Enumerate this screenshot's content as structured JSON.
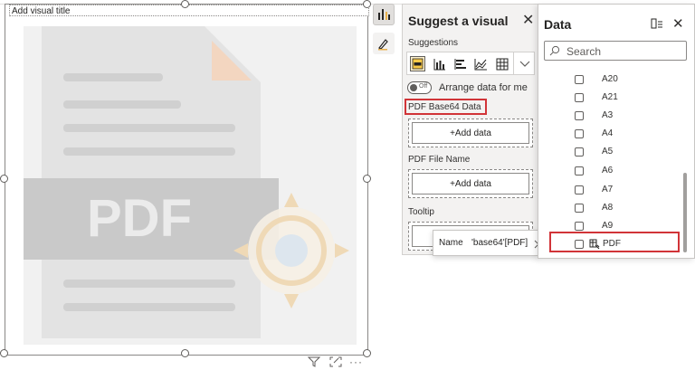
{
  "visual": {
    "title": "Add visual title",
    "placeholder_text": "PDF"
  },
  "suggest_pane": {
    "title": "Suggest a visual",
    "suggestions_label": "Suggestions",
    "toggle_state": "Off",
    "arrange_label": "Arrange data for me",
    "wells": [
      {
        "label": "PDF Base64 Data",
        "button": "+Add data"
      },
      {
        "label": "PDF File Name",
        "button": "+Add data"
      },
      {
        "label": "Tooltip",
        "button": ""
      }
    ]
  },
  "tooltip": {
    "key": "Name",
    "value": "'base64'[PDF]"
  },
  "data_pane": {
    "title": "Data",
    "search_placeholder": "Search",
    "fields": [
      "A20",
      "A21",
      "A3",
      "A4",
      "A5",
      "A6",
      "A7",
      "A8",
      "A9",
      "PDF"
    ]
  },
  "colors": {
    "highlight": "#d13438",
    "pane_bg": "#f3f2f1",
    "accent": "#e8b04b"
  },
  "icons": [
    "bar-chart-icon",
    "paint-brush-icon",
    "close-icon",
    "pdf-visual-icon",
    "column-chart-icon",
    "stacked-bar-icon",
    "line-chart-icon",
    "table-icon",
    "chevron-down-icon",
    "search-icon",
    "data-model-icon",
    "filter-icon",
    "focus-mode-icon",
    "more-options-icon",
    "chevron-right-icon",
    "calculated-table-icon"
  ]
}
